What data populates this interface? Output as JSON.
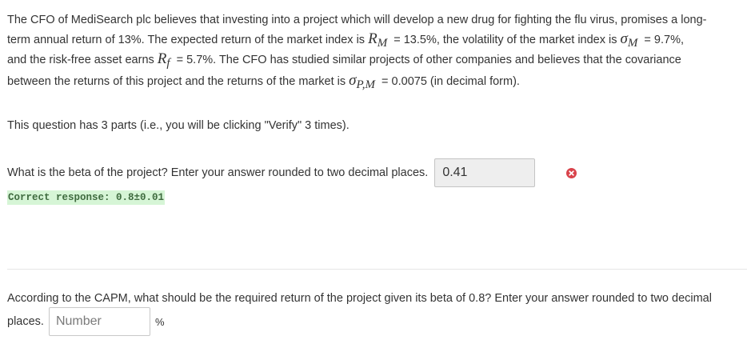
{
  "intro": {
    "l1": "The CFO of MediSearch plc believes that investing into a project which will develop a new drug for fighting the flu virus, promises a long-",
    "l2a": "term annual return of 13%. The expected return of the market index is ",
    "rm_sym": "R",
    "rm_sub": "M",
    "l2b": " = 13.5%, the volatility of the market index is ",
    "sm_sym": "σ",
    "sm_sub": "M",
    "l2c": " = 9.7%,",
    "l3a": "and the risk-free asset earns ",
    "rf_sym": "R",
    "rf_sub": "f",
    "l3b": " = 5.7%. The CFO has studied similar projects of other companies and believes that the covariance",
    "l4a": "between the returns of this project and the returns of the market is ",
    "cov_sym": "σ",
    "cov_sub": "P,M",
    "l4b": " = 0.0075 (in decimal form)."
  },
  "parts_note": "This question has 3 parts (i.e., you will be clicking \"Verify\" 3 times).",
  "q1": {
    "prompt": "What is the beta of the project? Enter your answer rounded to two decimal places.",
    "answer": "0.41",
    "correct_response": "Correct response: 0.8±0.01",
    "status_color": "#d9434b"
  },
  "q2": {
    "prompt_l1": "According to the CAPM, what should be the required return of the project given its beta of 0.8? Enter your answer rounded to two decimal",
    "prompt_l2": "places.",
    "placeholder": "Number",
    "unit": "%"
  }
}
